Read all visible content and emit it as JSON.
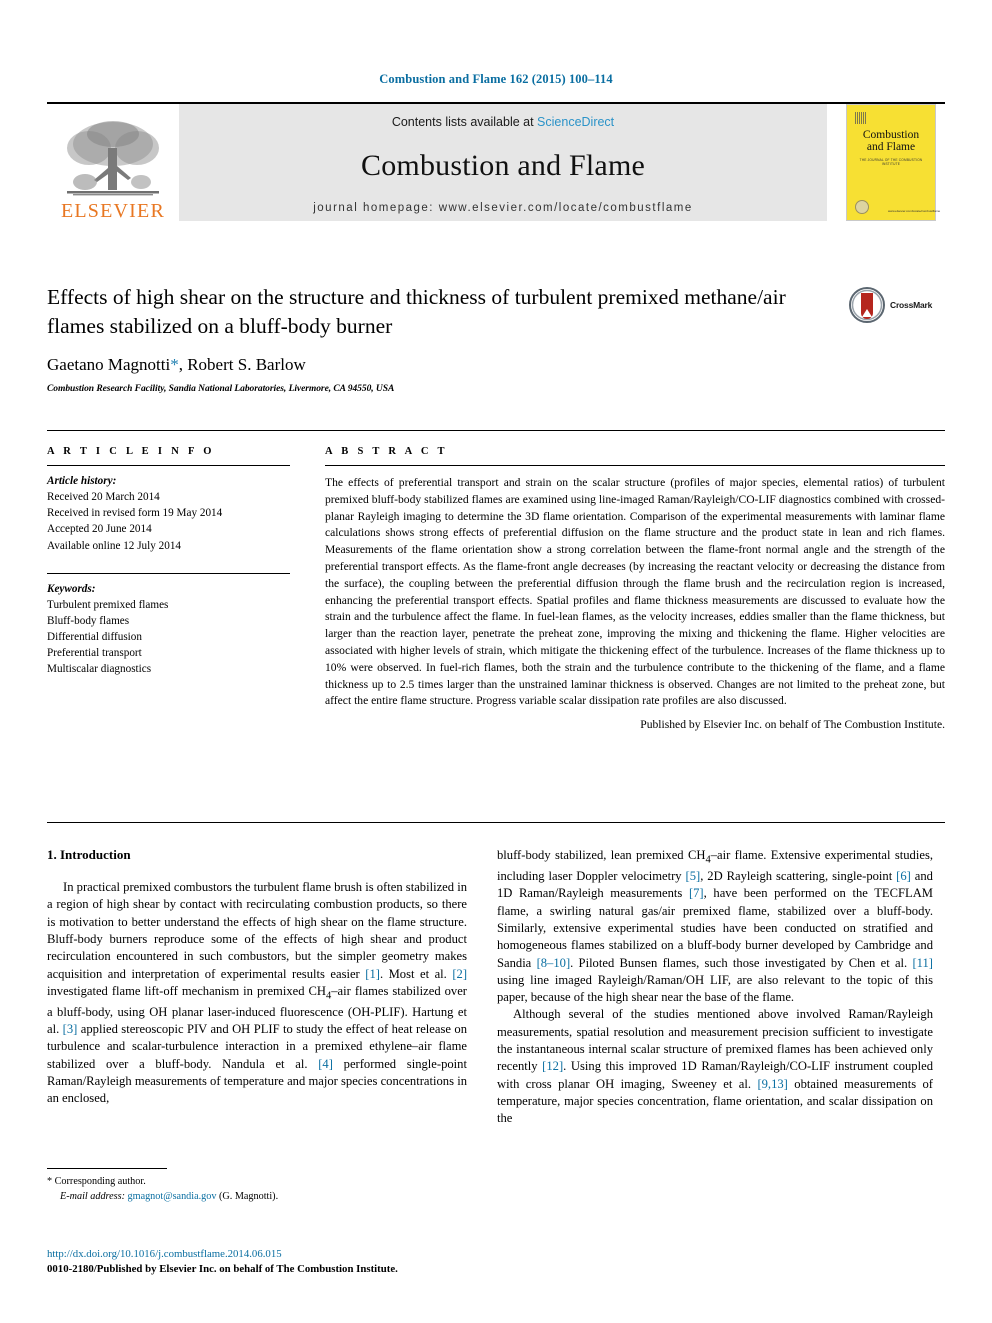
{
  "running_head": "Combustion and Flame 162 (2015) 100–114",
  "masthead": {
    "publisher_logo_text": "ELSEVIER",
    "contents_prefix": "Contents lists available at ",
    "contents_link": "ScienceDirect",
    "journal_name": "Combustion and Flame",
    "homepage_line": "journal homepage: www.elsevier.com/locate/combustflame",
    "cover": {
      "title_line1": "Combustion",
      "title_line2": "and Flame",
      "subtitle": "THE JOURNAL OF THE COMBUSTION INSTITUTE",
      "footer_text": "www.elsevier.com/locate/combustflame"
    }
  },
  "article": {
    "title": "Effects of high shear on the structure and thickness of turbulent premixed methane/air flames stabilized on a bluff-body burner",
    "crossmark_label": "CrossMark",
    "authors_plain": "Gaetano Magnotti",
    "authors_rest": ", Robert S. Barlow",
    "corresponding_marker": "*",
    "affiliation": "Combustion Research Facility, Sandia National Laboratories, Livermore, CA 94550, USA"
  },
  "article_info": {
    "heading": "A R T I C L E   I N F O",
    "history_label": "Article history:",
    "history": [
      "Received 20 March 2014",
      "Received in revised form 19 May 2014",
      "Accepted 20 June 2014",
      "Available online 12 July 2014"
    ],
    "keywords_label": "Keywords:",
    "keywords": [
      "Turbulent premixed flames",
      "Bluff-body flames",
      "Differential diffusion",
      "Preferential transport",
      "Multiscalar diagnostics"
    ]
  },
  "abstract": {
    "heading": "A B S T R A C T",
    "text": "The effects of preferential transport and strain on the scalar structure (profiles of major species, elemental ratios) of turbulent premixed bluff-body stabilized flames are examined using line-imaged Raman/Rayleigh/CO-LIF diagnostics combined with crossed-planar Rayleigh imaging to determine the 3D flame orientation. Comparison of the experimental measurements with laminar flame calculations shows strong effects of preferential diffusion on the flame structure and the product state in lean and rich flames. Measurements of the flame orientation show a strong correlation between the flame-front normal angle and the strength of the preferential transport effects. As the flame-front angle decreases (by increasing the reactant velocity or decreasing the distance from the surface), the coupling between the preferential diffusion through the flame brush and the recirculation region is increased, enhancing the preferential transport effects. Spatial profiles and flame thickness measurements are discussed to evaluate how the strain and the turbulence affect the flame. In fuel-lean flames, as the velocity increases, eddies smaller than the flame thickness, but larger than the reaction layer, penetrate the preheat zone, improving the mixing and thickening the flame. Higher velocities are associated with higher levels of strain, which mitigate the thickening effect of the turbulence. Increases of the flame thickness up to 10% were observed. In fuel-rich flames, both the strain and the turbulence contribute to the thickening of the flame, and a flame thickness up to 2.5 times larger than the unstrained laminar thickness is observed. Changes are not limited to the preheat zone, but affect the entire flame structure. Progress variable scalar dissipation rate profiles are also discussed.",
    "publisher_line": "Published by Elsevier Inc. on behalf of The Combustion Institute."
  },
  "body": {
    "section_number_title": "1. Introduction",
    "left_paragraph_1_a": "In practical premixed combustors the turbulent flame brush is often stabilized in a region of high shear by contact with recirculating combustion products, so there is motivation to better understand the effects of high shear on the flame structure. Bluff-body burners reproduce some of the effects of high shear and product recirculation encountered in such combustors, but the simpler geometry makes acquisition and interpretation of experimental results easier ",
    "ref1": "[1]",
    "left_paragraph_1_b": ". Most et al. ",
    "ref2": "[2]",
    "left_paragraph_1_c": " investigated flame lift-off mechanism in premixed CH",
    "left_paragraph_1_c2": "–air flames stabilized over a bluff-body, using OH planar laser-induced fluorescence (OH-PLIF). Hartung et al. ",
    "ref3": "[3]",
    "left_paragraph_1_d": " applied stereoscopic PIV and OH PLIF to study the effect of heat release on turbulence and scalar-turbulence interaction in a premixed ethylene–air flame stabilized over a bluff-body. Nandula et al. ",
    "ref4": "[4]",
    "left_paragraph_1_e": " performed single-point Raman/Rayleigh measurements of temperature and major species concentrations in an enclosed,",
    "right_paragraph_1_a": "bluff-body stabilized, lean premixed CH",
    "right_paragraph_1_a2": "–air flame. Extensive experimental studies, including laser Doppler velocimetry ",
    "ref5": "[5]",
    "right_paragraph_1_b": ", 2D Rayleigh scattering, single-point ",
    "ref6": "[6]",
    "right_paragraph_1_c": " and 1D Raman/Rayleigh measurements ",
    "ref7": "[7]",
    "right_paragraph_1_d": ", have been performed on the TECFLAM flame, a swirling natural gas/air premixed flame, stabilized over a bluff-body. Similarly, extensive experimental studies have been conducted on stratified and homogeneous flames stabilized on a bluff-body burner developed by Cambridge and Sandia ",
    "ref8": "[8–10]",
    "right_paragraph_1_e": ". Piloted Bunsen flames, such those investigated by Chen et al. ",
    "ref11": "[11]",
    "right_paragraph_1_f": " using line imaged Rayleigh/Raman/OH LIF, are also relevant to the topic of this paper, because of the high shear near the base of the flame.",
    "right_paragraph_2_a": "Although several of the studies mentioned above involved Raman/Rayleigh measurements, spatial resolution and measurement precision sufficient to investigate the instantaneous internal scalar structure of premixed flames has been achieved only recently ",
    "ref12": "[12]",
    "right_paragraph_2_b": ". Using this improved 1D Raman/Rayleigh/CO-LIF instrument coupled with cross planar OH imaging, Sweeney et al. ",
    "ref913": "[9,13]",
    "right_paragraph_2_c": " obtained measurements of temperature, major species concentration, flame orientation, and scalar dissipation on the"
  },
  "footnote": {
    "corresponding_marker": "*",
    "corresponding_text": " Corresponding author.",
    "email_label": "E-mail address:",
    "email": "gmagnot@sandia.gov",
    "email_suffix": " (G. Magnotti)."
  },
  "footer": {
    "doi": "http://dx.doi.org/10.1016/j.combustflame.2014.06.015",
    "issn_line": "0010-2180/Published by Elsevier Inc. on behalf of The Combustion Institute."
  },
  "colors": {
    "link_blue": "#0a6ea1",
    "sciencedirect_blue": "#2b93c8",
    "elsevier_orange": "#e87722",
    "band_grey": "#e6e6e6",
    "cover_yellow": "#f7e033"
  }
}
